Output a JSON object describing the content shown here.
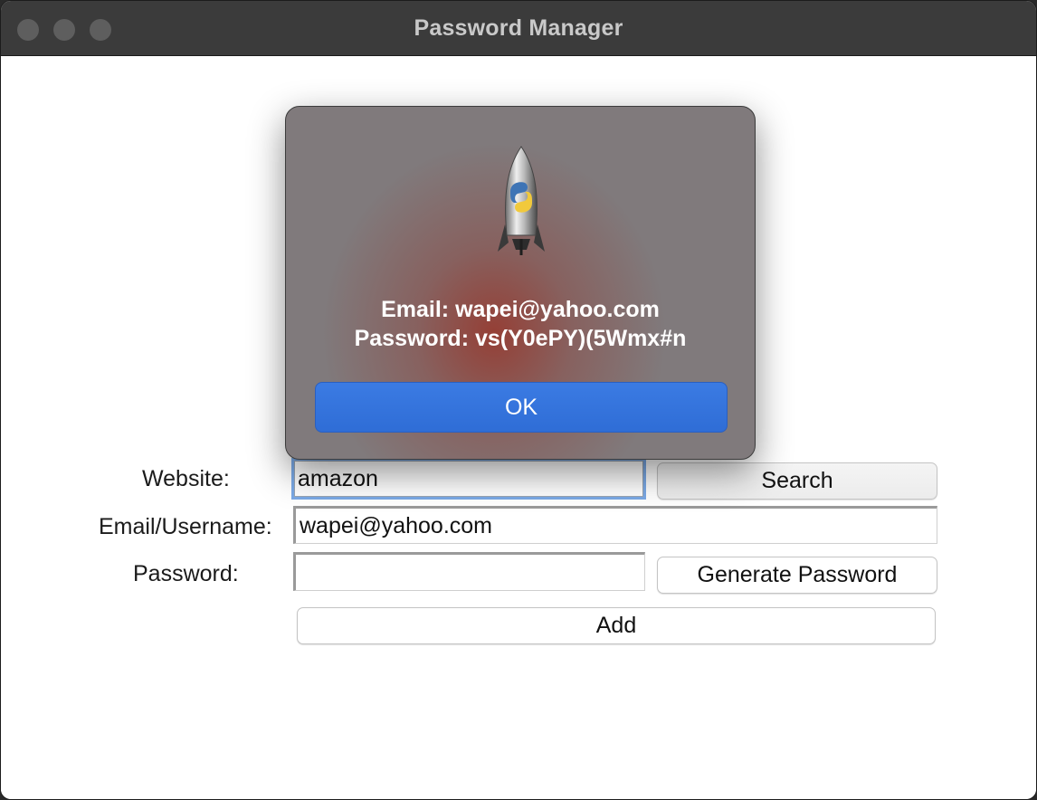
{
  "window": {
    "title": "Password Manager"
  },
  "dialog": {
    "email_line": "Email: wapei@yahoo.com",
    "password_line": "Password: vs(Y0ePY)(5Wmx#n",
    "ok_label": "OK",
    "icon": "python-rocket-launcher-icon"
  },
  "form": {
    "website_label": "Website:",
    "website_value": "amazon",
    "email_label": "Email/Username:",
    "email_value": "wapei@yahoo.com",
    "password_label": "Password:",
    "password_value": "",
    "search_label": "Search",
    "generate_label": "Generate Password",
    "add_label": "Add"
  },
  "colors": {
    "titlebar": "#3b3b3b",
    "ok_button": "#3b7be3",
    "focus_ring": "#7aa9e6"
  }
}
